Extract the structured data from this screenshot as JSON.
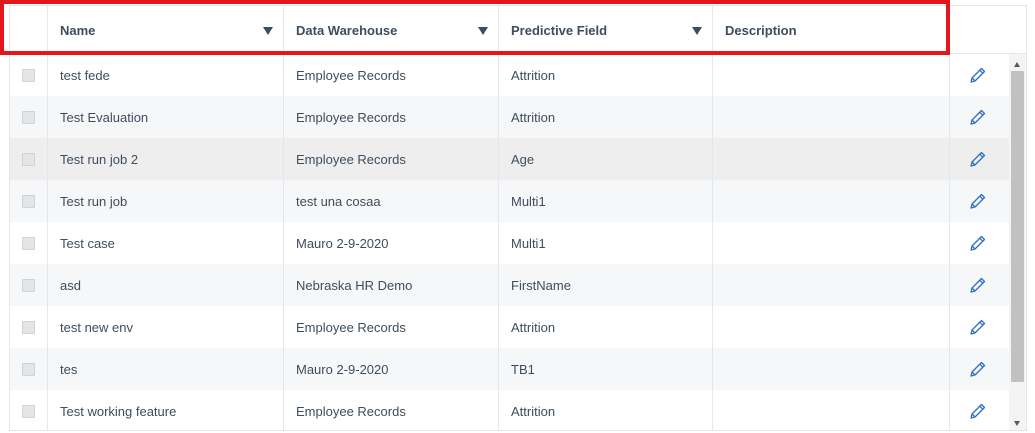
{
  "columns": {
    "name": "Name",
    "data_warehouse": "Data Warehouse",
    "predictive_field": "Predictive Field",
    "description": "Description"
  },
  "rows": [
    {
      "name": "test fede",
      "data_warehouse": "Employee Records",
      "predictive_field": "Attrition",
      "description": ""
    },
    {
      "name": "Test Evaluation",
      "data_warehouse": "Employee Records",
      "predictive_field": "Attrition",
      "description": ""
    },
    {
      "name": "Test run job 2",
      "data_warehouse": "Employee Records",
      "predictive_field": "Age",
      "description": ""
    },
    {
      "name": "Test run job",
      "data_warehouse": "test una cosaa",
      "predictive_field": "Multi1",
      "description": ""
    },
    {
      "name": "Test case",
      "data_warehouse": "Mauro 2-9-2020",
      "predictive_field": "Multi1",
      "description": ""
    },
    {
      "name": "asd",
      "data_warehouse": "Nebraska HR Demo",
      "predictive_field": "FirstName",
      "description": ""
    },
    {
      "name": "test new env",
      "data_warehouse": "Employee Records",
      "predictive_field": "Attrition",
      "description": ""
    },
    {
      "name": "tes",
      "data_warehouse": "Mauro 2-9-2020",
      "predictive_field": "TB1",
      "description": ""
    },
    {
      "name": "Test working feature",
      "data_warehouse": "Employee Records",
      "predictive_field": "Attrition",
      "description": ""
    }
  ],
  "icons": {
    "sort": "caret-down-icon",
    "edit": "pencil-icon",
    "row_select": "checkbox"
  },
  "colors": {
    "highlight": "#e3161d",
    "edit_icon": "#2f6fbf",
    "text": "#3e4d5c"
  }
}
